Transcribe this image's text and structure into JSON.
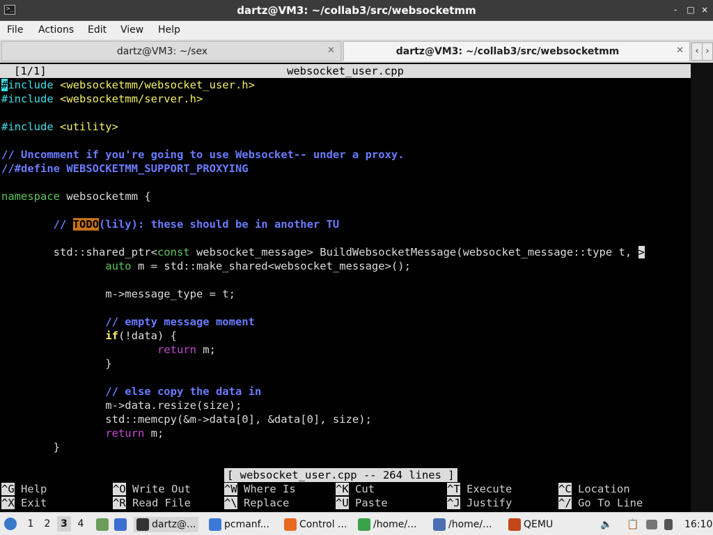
{
  "window": {
    "title": "dartz@VM3: ~/collab3/src/websocketmm",
    "controls": [
      "-",
      "□",
      "×"
    ]
  },
  "menu": [
    "File",
    "Actions",
    "Edit",
    "View",
    "Help"
  ],
  "tabs": [
    {
      "label": "dartz@VM3: ~/sex",
      "active": false
    },
    {
      "label": "dartz@VM3: ~/collab3/src/websocketmm",
      "active": true
    }
  ],
  "tab_arrows": [
    "‹",
    "›"
  ],
  "editor": {
    "buffer_index": "[1/1]",
    "filename": "websocket_user.cpp",
    "status_message": "[ websocket_user.cpp -- 264 lines ]",
    "lines": [
      "#include <websocketmm/websocket_user.h>",
      "#include <websocketmm/server.h>",
      "",
      "#include <utility>",
      "",
      "// Uncomment if you're going to use Websocket-- under a proxy.",
      "//#define WEBSOCKETMM_SUPPORT_PROXYING",
      "",
      "namespace websocketmm {",
      "",
      "        // TODO(lily): these should be in another TU",
      "",
      "        std::shared_ptr<const websocket_message> BuildWebsocketMessage(websocket_message::type t, >",
      "                auto m = std::make_shared<websocket_message>();",
      "",
      "                m->message_type = t;",
      "",
      "                // empty message moment",
      "                if(!data) {",
      "                        return m;",
      "                }",
      "",
      "                // else copy the data in",
      "                m->data.resize(size);",
      "                std::memcpy(&m->data[0], &data[0], size);",
      "                return m;",
      "        }"
    ],
    "shortcuts": [
      {
        "key": "^G",
        "label": "Help"
      },
      {
        "key": "^O",
        "label": "Write Out"
      },
      {
        "key": "^W",
        "label": "Where Is"
      },
      {
        "key": "^K",
        "label": "Cut"
      },
      {
        "key": "^T",
        "label": "Execute"
      },
      {
        "key": "^C",
        "label": "Location"
      },
      {
        "key": "^X",
        "label": "Exit"
      },
      {
        "key": "^R",
        "label": "Read File"
      },
      {
        "key": "^\\",
        "label": "Replace"
      },
      {
        "key": "^U",
        "label": "Paste"
      },
      {
        "key": "^J",
        "label": "Justify"
      },
      {
        "key": "^/",
        "label": "Go To Line"
      }
    ]
  },
  "taskbar": {
    "workspaces": [
      "1",
      "2",
      "3",
      "4"
    ],
    "active_workspace": "3",
    "tasks": [
      {
        "label": "dartz@...",
        "icon": "terminal-icon"
      },
      {
        "label": "pcmanf...",
        "icon": "folder-icon"
      },
      {
        "label": "Control ...",
        "icon": "firefox-icon"
      },
      {
        "label": "/home/...",
        "icon": "text-editor-icon"
      },
      {
        "label": "/home/...",
        "icon": "document-icon"
      },
      {
        "label": "QEMU",
        "icon": "qemu-icon"
      }
    ],
    "clock": "16:10"
  },
  "colors": {
    "cyan": "#3fe0e8",
    "yellow": "#f4f06a",
    "blue": "#6b7cff",
    "green": "#5cc85c",
    "magenta": "#c64ad4",
    "todo": "#c7711c"
  }
}
